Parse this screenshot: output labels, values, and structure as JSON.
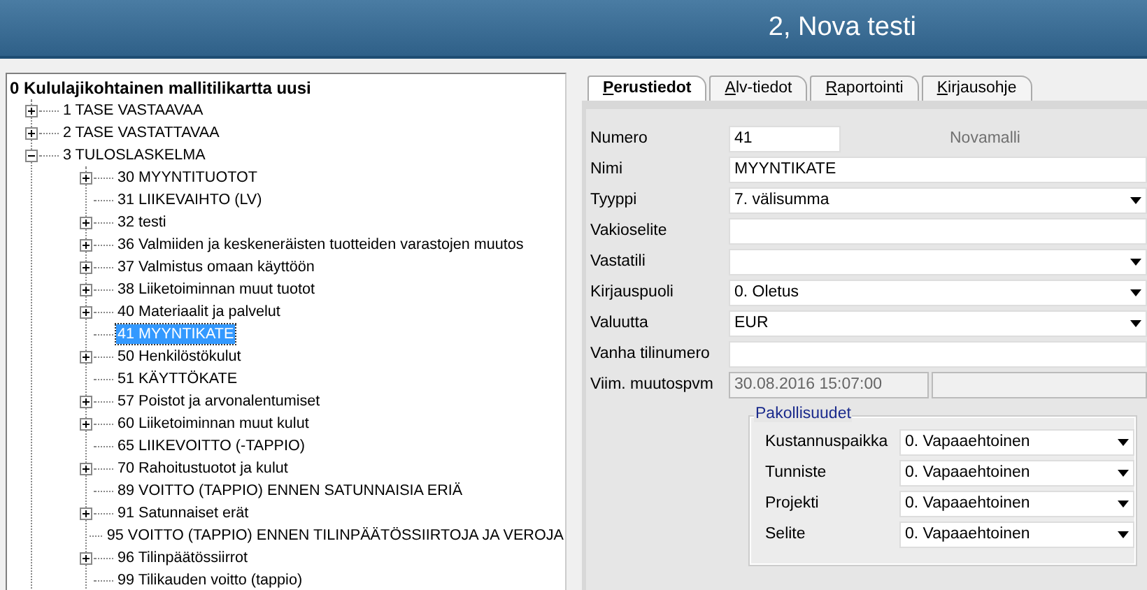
{
  "header": {
    "title": "2, Nova testi"
  },
  "tree": {
    "root": "0 Kululajikohtainen mallitilikartta uusi",
    "items": [
      {
        "label": "1 TASE VASTAAVAA",
        "expandable": true,
        "expanded": false,
        "selected": false
      },
      {
        "label": "2 TASE VASTATTAVAA",
        "expandable": true,
        "expanded": false,
        "selected": false
      },
      {
        "label": "3 TULOSLASKELMA",
        "expandable": true,
        "expanded": true,
        "selected": false,
        "children": [
          {
            "label": "30 MYYNTITUOTOT",
            "expandable": true,
            "expanded": false,
            "selected": false
          },
          {
            "label": "31 LIIKEVAIHTO (LV)",
            "expandable": false,
            "selected": false
          },
          {
            "label": "32 testi",
            "expandable": true,
            "expanded": false,
            "selected": false
          },
          {
            "label": "36 Valmiiden ja keskeneräisten tuotteiden varastojen muutos",
            "expandable": true,
            "expanded": false,
            "selected": false
          },
          {
            "label": "37 Valmistus omaan käyttöön",
            "expandable": true,
            "expanded": false,
            "selected": false
          },
          {
            "label": "38 Liiketoiminnan muut tuotot",
            "expandable": true,
            "expanded": false,
            "selected": false
          },
          {
            "label": "40 Materiaalit ja palvelut",
            "expandable": true,
            "expanded": false,
            "selected": false
          },
          {
            "label": "41 MYYNTIKATE",
            "expandable": false,
            "selected": true
          },
          {
            "label": "50 Henkilöstökulut",
            "expandable": true,
            "expanded": false,
            "selected": false
          },
          {
            "label": "51 KÄYTTÖKATE",
            "expandable": false,
            "selected": false
          },
          {
            "label": "57 Poistot ja arvonalentumiset",
            "expandable": true,
            "expanded": false,
            "selected": false
          },
          {
            "label": "60 Liiketoiminnan muut kulut",
            "expandable": true,
            "expanded": false,
            "selected": false
          },
          {
            "label": "65 LIIKEVOITTO (-TAPPIO)",
            "expandable": false,
            "selected": false
          },
          {
            "label": "70 Rahoitustuotot ja kulut",
            "expandable": true,
            "expanded": false,
            "selected": false
          },
          {
            "label": "89 VOITTO (TAPPIO) ENNEN SATUNNAISIA ERIÄ",
            "expandable": false,
            "selected": false
          },
          {
            "label": "91 Satunnaiset erät",
            "expandable": true,
            "expanded": false,
            "selected": false
          },
          {
            "label": "95 VOITTO (TAPPIO) ENNEN TILINPÄÄTÖSSIIRTOJA JA VEROJA",
            "expandable": false,
            "selected": false
          },
          {
            "label": "96 Tilinpäätössiirrot",
            "expandable": true,
            "expanded": false,
            "selected": false
          },
          {
            "label": "99 Tilikauden voitto (tappio)",
            "expandable": false,
            "selected": false
          }
        ]
      }
    ]
  },
  "tabs": [
    {
      "label": "Perustiedot",
      "selected": true
    },
    {
      "label": "Alv-tiedot",
      "selected": false
    },
    {
      "label": "Raportointi",
      "selected": false
    },
    {
      "label": "Kirjausohje",
      "selected": false
    }
  ],
  "form": {
    "fields": [
      {
        "kind": "text_note",
        "label": "Numero",
        "value": "41",
        "note": "Novamalli"
      },
      {
        "kind": "text",
        "label": "Nimi",
        "value": "MYYNTIKATE"
      },
      {
        "kind": "select",
        "label": "Tyyppi",
        "value": "7. välisumma"
      },
      {
        "kind": "text",
        "label": "Vakioselite"
      },
      {
        "kind": "select",
        "label": "Vastatili"
      },
      {
        "kind": "select",
        "label": "Kirjauspuoli",
        "value": "0. Oletus"
      },
      {
        "kind": "select",
        "label": "Valuutta",
        "value": "EUR"
      },
      {
        "kind": "text",
        "label": "Vanha tilinumero"
      },
      {
        "kind": "readonly_pair",
        "label": "Viim. muutospvm",
        "value": "30.08.2016 15:07:00"
      }
    ],
    "group": {
      "title": "Pakollisuudet",
      "rows": [
        {
          "label": "Kustannuspaikka",
          "value": "0. Vapaaehtoinen"
        },
        {
          "label": "Tunniste",
          "value": "0. Vapaaehtoinen"
        },
        {
          "label": "Projekti",
          "value": "0. Vapaaehtoinen"
        },
        {
          "label": "Selite",
          "value": "0. Vapaaehtoinen"
        }
      ]
    }
  }
}
